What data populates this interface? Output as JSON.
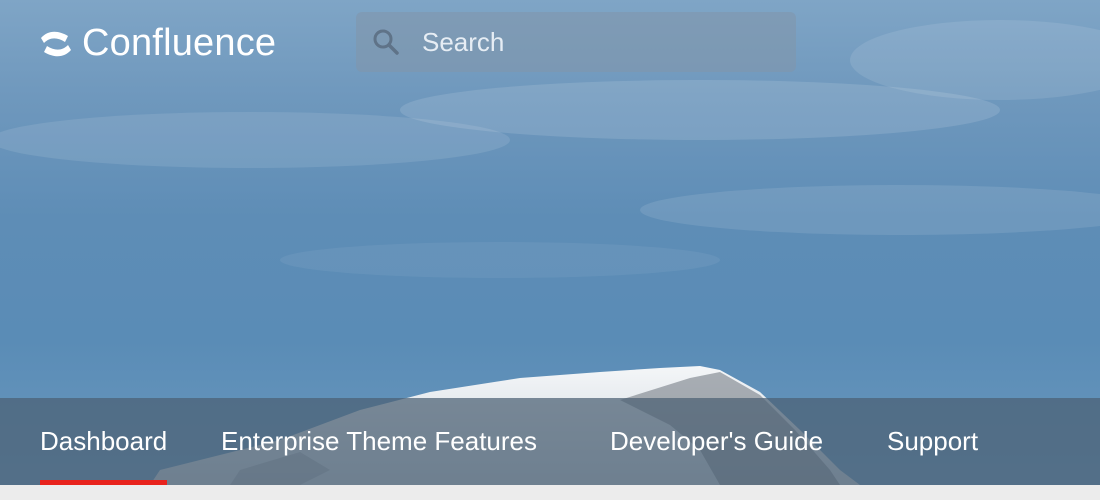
{
  "app": {
    "name": "Confluence"
  },
  "search": {
    "placeholder": "Search"
  },
  "nav": {
    "items": [
      {
        "label": "Dashboard",
        "active": true
      },
      {
        "label": "Enterprise Theme Features",
        "active": false
      },
      {
        "label": "Developer's Guide",
        "active": false
      },
      {
        "label": "Support",
        "active": false
      }
    ]
  },
  "colors": {
    "accent": "#e8231d",
    "text": "#ffffff"
  },
  "icons": {
    "logo": "confluence-logo-icon",
    "search": "search-icon"
  }
}
